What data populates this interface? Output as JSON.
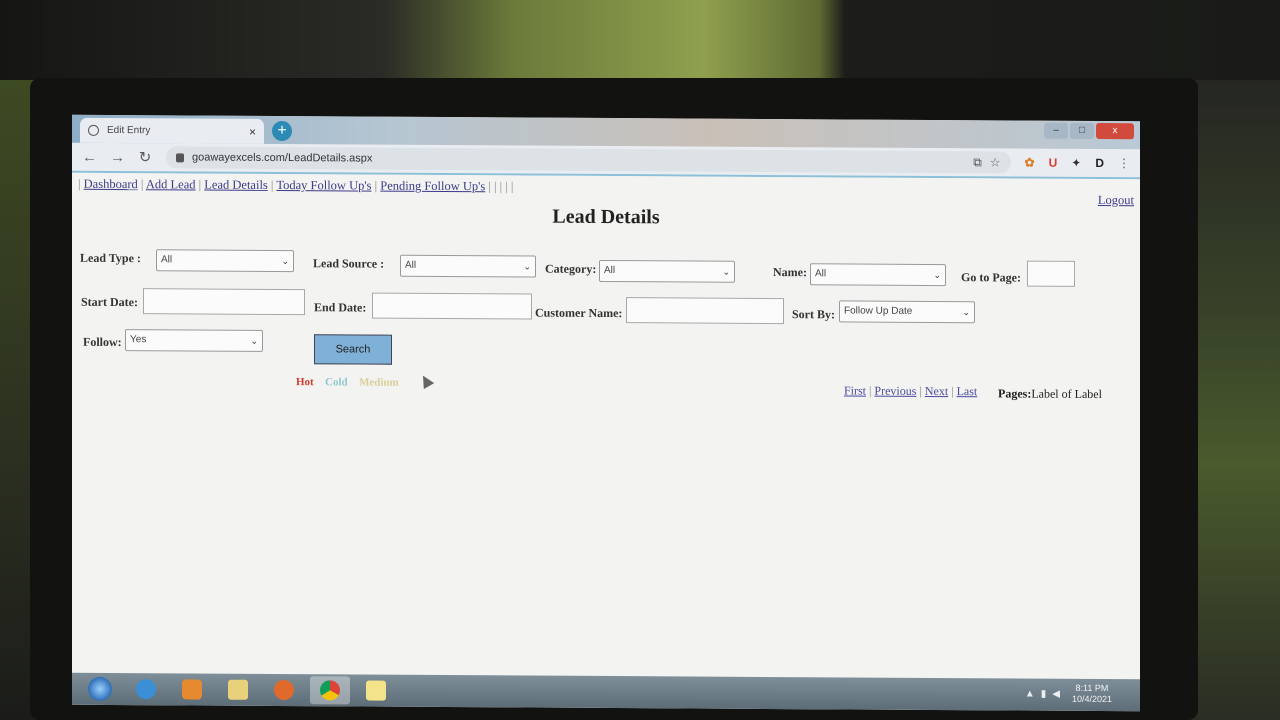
{
  "browser": {
    "tab_title": "Edit Entry",
    "new_tab": "+",
    "close_tab": "×",
    "url": "goawayexcels.com/LeadDetails.aspx",
    "window_controls": {
      "minimize": "–",
      "maximize": "□",
      "close": "x"
    }
  },
  "page": {
    "nav": {
      "sep": "|",
      "links": [
        "Dashboard",
        "Add Lead",
        "Lead Details",
        "Today Follow Up's",
        "Pending Follow Up's"
      ],
      "trailing": "| | | | |"
    },
    "logout": "Logout",
    "title": "Lead Details",
    "filters": {
      "lead_type": {
        "label": "Lead Type :",
        "value": "All"
      },
      "lead_source": {
        "label": "Lead Source :",
        "value": "All"
      },
      "category": {
        "label": "Category:",
        "value": "All"
      },
      "name": {
        "label": "Name:",
        "value": "All"
      },
      "go_to_page": {
        "label": "Go to Page:",
        "value": ""
      },
      "start_date": {
        "label": "Start Date:",
        "value": ""
      },
      "end_date": {
        "label": "End Date:",
        "value": ""
      },
      "customer_name": {
        "label": "Customer Name:",
        "value": ""
      },
      "sort_by": {
        "label": "Sort By:",
        "value": "Follow Up Date"
      },
      "follow": {
        "label": "Follow:",
        "value": "Yes"
      }
    },
    "search_button": "Search",
    "legend": [
      {
        "label": "Hot",
        "color": "#d23b2f"
      },
      {
        "label": "Cold",
        "color": "#8fc9cf"
      },
      {
        "label": "Medium",
        "color": "#d9cf98"
      }
    ],
    "pager": {
      "first": "First",
      "previous": "Previous",
      "next": "Next",
      "last": "Last",
      "pages_label": "Pages:",
      "pages_value": "Label of Label"
    }
  },
  "taskbar": {
    "time": "8:11 PM",
    "date": "10/4/2021"
  }
}
